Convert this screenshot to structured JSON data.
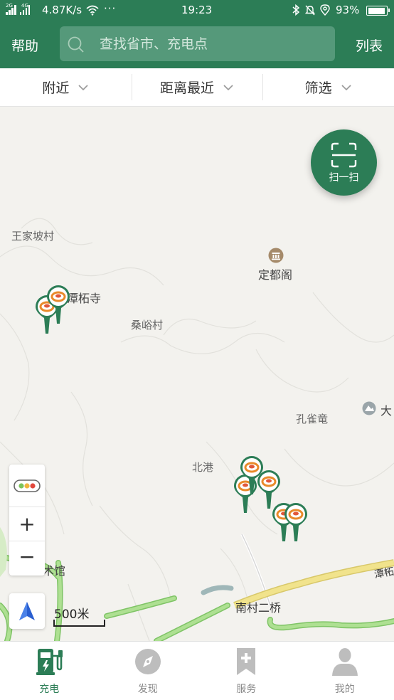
{
  "status_bar": {
    "network_speed": "4.87K/s",
    "more": "···",
    "time": "19:23",
    "battery_percent": "93%",
    "battery_level": 0.93,
    "sim_labels": [
      "2G",
      "4G"
    ]
  },
  "header": {
    "help_label": "帮助",
    "search_placeholder": "查找省市、充电点",
    "list_label": "列表"
  },
  "filters": [
    {
      "label": "附近"
    },
    {
      "label": "距离最近"
    },
    {
      "label": "筛选"
    }
  ],
  "map": {
    "scan_label": "扫一扫",
    "place_labels": {
      "wangjiapo": "王家坡村",
      "tanzhesi": "潭柘寺",
      "dingduge": "定都阁",
      "sangyu": "桑峪村",
      "kongque": "孔雀竜",
      "da": "大",
      "beigang": "北港",
      "shuguan": "术馆",
      "nancun": "南村二桥",
      "tan_road": "潭柘"
    },
    "scale_label": "500米"
  },
  "tabs": [
    {
      "label": "充电",
      "icon": "charging-station-icon",
      "active": true
    },
    {
      "label": "发现",
      "icon": "compass-icon",
      "active": false
    },
    {
      "label": "服务",
      "icon": "bookmark-plus-icon",
      "active": false
    },
    {
      "label": "我的",
      "icon": "user-icon",
      "active": false
    }
  ],
  "colors": {
    "brand_green": "#2c7d56",
    "search_bg": "#55997a",
    "road_green": "#9fd67f",
    "road_yellow": "#f1e38c"
  }
}
